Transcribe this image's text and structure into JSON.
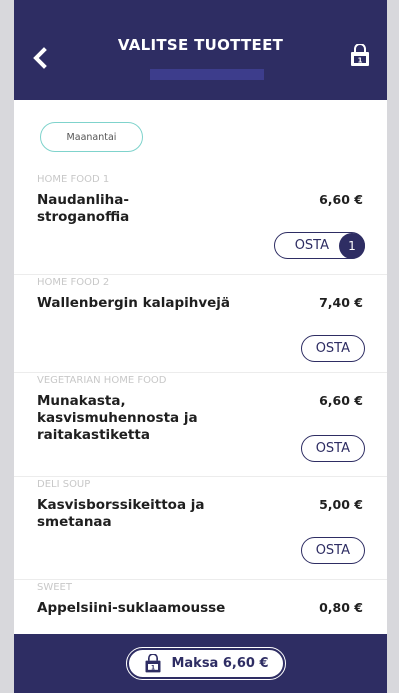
{
  "header": {
    "title": "VALITSE TUOTTEET"
  },
  "day_filter": {
    "label": "Maanantai"
  },
  "items": [
    {
      "category": "HOME FOOD 1",
      "name": "Naudanliha-stroganoffia",
      "price": "6,60 €",
      "buy_label": "OSTA",
      "count": "1"
    },
    {
      "category": "HOME FOOD 2",
      "name": "Wallenbergin kalapihvejä",
      "price": "7,40 €",
      "buy_label": "OSTA"
    },
    {
      "category": "VEGETARIAN HOME FOOD",
      "name": "Munakasta, kasvismuhennosta ja raitakastiketta",
      "price": "6,60 €",
      "buy_label": "OSTA"
    },
    {
      "category": "DELI SOUP",
      "name": "Kasvisborssikeittoa ja smetanaa",
      "price": "5,00 €",
      "buy_label": "OSTA"
    },
    {
      "category": "SWEET",
      "name": "Appelsiini-suklaamousse",
      "price": "0,80 €"
    }
  ],
  "footer": {
    "pay_label": "Maksa 6,60 €"
  },
  "icons": {
    "back": "chevron-left-icon",
    "cart": "shopping-bag-icon"
  },
  "colors": {
    "primary": "#2e2d63",
    "accent": "#7fd3cc"
  }
}
